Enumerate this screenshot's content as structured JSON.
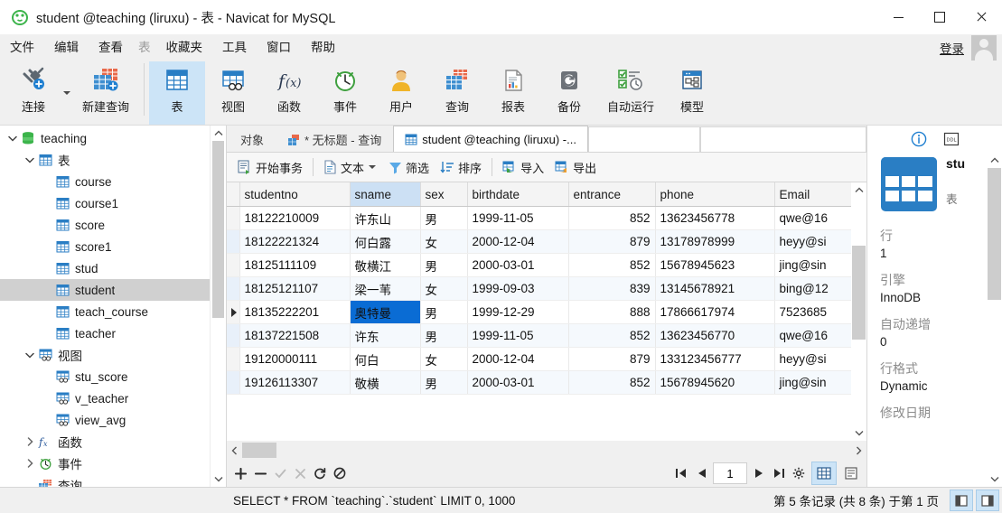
{
  "window": {
    "title": "student @teaching (liruxu) - 表 - Navicat for MySQL",
    "app_icon": "navicat-logo-icon",
    "minimize_label": "最小化",
    "maximize_label": "最大化",
    "close_label": "关闭"
  },
  "menubar": {
    "items": [
      {
        "label": "文件",
        "name": "menu-file",
        "disabled": false
      },
      {
        "label": "编辑",
        "name": "menu-edit",
        "disabled": false
      },
      {
        "label": "查看",
        "name": "menu-view",
        "disabled": false
      },
      {
        "label": "表",
        "name": "menu-table",
        "disabled": true
      },
      {
        "label": "收藏夹",
        "name": "menu-favorites",
        "disabled": false
      },
      {
        "label": "工具",
        "name": "menu-tools",
        "disabled": false
      },
      {
        "label": "窗口",
        "name": "menu-window",
        "disabled": false
      },
      {
        "label": "帮助",
        "name": "menu-help",
        "disabled": false
      }
    ],
    "login_label": "登录"
  },
  "toolbar": {
    "groups": [
      [
        {
          "label": "连接",
          "icon": "connection-icon",
          "name": "toolbar-connection",
          "has_caret": true,
          "wide": false
        },
        {
          "label": "新建查询",
          "icon": "new-query-icon",
          "name": "toolbar-new-query",
          "has_caret": false,
          "wide": true
        }
      ],
      [
        {
          "label": "表",
          "icon": "table-icon",
          "name": "toolbar-table",
          "active": true
        },
        {
          "label": "视图",
          "icon": "view-icon",
          "name": "toolbar-view",
          "active": false
        },
        {
          "label": "函数",
          "icon": "function-icon",
          "name": "toolbar-function",
          "active": false
        },
        {
          "label": "事件",
          "icon": "event-icon",
          "name": "toolbar-event",
          "active": false
        },
        {
          "label": "用户",
          "icon": "user-icon",
          "name": "toolbar-user",
          "active": false
        },
        {
          "label": "查询",
          "icon": "query-icon",
          "name": "toolbar-query",
          "active": false
        },
        {
          "label": "报表",
          "icon": "report-icon",
          "name": "toolbar-report",
          "active": false
        },
        {
          "label": "备份",
          "icon": "backup-icon",
          "name": "toolbar-backup",
          "active": false
        },
        {
          "label": "自动运行",
          "icon": "automation-icon",
          "name": "toolbar-automation",
          "active": false,
          "wide": true
        },
        {
          "label": "模型",
          "icon": "model-icon",
          "name": "toolbar-model",
          "active": false
        }
      ]
    ]
  },
  "sidebar": {
    "items": [
      {
        "label": "teaching",
        "icon": "database-icon",
        "indent": 0,
        "chevron": "down",
        "selected": false
      },
      {
        "label": "表",
        "icon": "table-icon",
        "indent": 1,
        "chevron": "down",
        "selected": false
      },
      {
        "label": "course",
        "icon": "table-icon",
        "indent": 2,
        "chevron": "none",
        "selected": false
      },
      {
        "label": "course1",
        "icon": "table-icon",
        "indent": 2,
        "chevron": "none",
        "selected": false
      },
      {
        "label": "score",
        "icon": "table-icon",
        "indent": 2,
        "chevron": "none",
        "selected": false
      },
      {
        "label": "score1",
        "icon": "table-icon",
        "indent": 2,
        "chevron": "none",
        "selected": false
      },
      {
        "label": "stud",
        "icon": "table-icon",
        "indent": 2,
        "chevron": "none",
        "selected": false
      },
      {
        "label": "student",
        "icon": "table-icon",
        "indent": 2,
        "chevron": "none",
        "selected": true
      },
      {
        "label": "teach_course",
        "icon": "table-icon",
        "indent": 2,
        "chevron": "none",
        "selected": false
      },
      {
        "label": "teacher",
        "icon": "table-icon",
        "indent": 2,
        "chevron": "none",
        "selected": false
      },
      {
        "label": "视图",
        "icon": "view-icon",
        "indent": 1,
        "chevron": "down",
        "selected": false
      },
      {
        "label": "stu_score",
        "icon": "view-icon",
        "indent": 2,
        "chevron": "none",
        "selected": false
      },
      {
        "label": "v_teacher",
        "icon": "view-icon",
        "indent": 2,
        "chevron": "none",
        "selected": false
      },
      {
        "label": "view_avg",
        "icon": "view-icon",
        "indent": 2,
        "chevron": "none",
        "selected": false
      },
      {
        "label": "函数",
        "icon": "function-icon",
        "indent": 1,
        "chevron": "right",
        "selected": false
      },
      {
        "label": "事件",
        "icon": "event-icon",
        "indent": 1,
        "chevron": "right",
        "selected": false
      },
      {
        "label": "查询",
        "icon": "query-icon",
        "indent": 1,
        "chevron": "none",
        "selected": false
      }
    ]
  },
  "tabs": [
    {
      "label": "对象",
      "icon": "none",
      "active": false,
      "name": "tab-objects"
    },
    {
      "label": "* 无标题 - 查询",
      "icon": "query-icon",
      "active": false,
      "name": "tab-untitled-query"
    },
    {
      "label": "student @teaching (liruxu) -...",
      "icon": "table-icon",
      "active": true,
      "name": "tab-student-table"
    }
  ],
  "grid_toolbar": {
    "buttons": [
      {
        "label": "开始事务",
        "icon": "transaction-icon",
        "name": "begin-transaction-button",
        "caret": false
      },
      {
        "label": "文本",
        "icon": "text-icon",
        "name": "text-button",
        "caret": true
      },
      {
        "label": "筛选",
        "icon": "filter-icon",
        "name": "filter-button",
        "caret": false
      },
      {
        "label": "排序",
        "icon": "sort-icon",
        "name": "sort-button",
        "caret": false
      },
      {
        "label": "导入",
        "icon": "import-icon",
        "name": "import-button",
        "caret": false
      },
      {
        "label": "导出",
        "icon": "export-icon",
        "name": "export-button",
        "caret": false
      }
    ]
  },
  "grid": {
    "columns": [
      "studentno",
      "sname",
      "sex",
      "birthdate",
      "entrance",
      "phone",
      "Email"
    ],
    "selected_column": "sname",
    "selected_row_index": 4,
    "selected_cell": {
      "row": 4,
      "column": "sname"
    },
    "rows": [
      {
        "studentno": "18122210009",
        "sname": "许东山",
        "sex": "男",
        "birthdate": "1999-11-05",
        "entrance": "852",
        "phone": "13623456778",
        "Email": "qwe@16"
      },
      {
        "studentno": "18122221324",
        "sname": "何白露",
        "sex": "女",
        "birthdate": "2000-12-04",
        "entrance": "879",
        "phone": "13178978999",
        "Email": "heyy@si"
      },
      {
        "studentno": "18125111109",
        "sname": "敬横江",
        "sex": "男",
        "birthdate": "2000-03-01",
        "entrance": "852",
        "phone": "15678945623",
        "Email": "jing@sin"
      },
      {
        "studentno": "18125121107",
        "sname": "梁一苇",
        "sex": "女",
        "birthdate": "1999-09-03",
        "entrance": "839",
        "phone": "13145678921",
        "Email": "bing@12"
      },
      {
        "studentno": "18135222201",
        "sname": "奥特曼",
        "sex": "男",
        "birthdate": "1999-12-29",
        "entrance": "888",
        "phone": "17866617974",
        "Email": "7523685"
      },
      {
        "studentno": "18137221508",
        "sname": "许东",
        "sex": "男",
        "birthdate": "1999-11-05",
        "entrance": "852",
        "phone": "13623456770",
        "Email": "qwe@16"
      },
      {
        "studentno": "19120000111",
        "sname": "何白",
        "sex": "女",
        "birthdate": "2000-12-04",
        "entrance": "879",
        "phone": "133123456777",
        "Email": "heyy@si"
      },
      {
        "studentno": "19126113307",
        "sname": "敬横",
        "sex": "男",
        "birthdate": "2000-03-01",
        "entrance": "852",
        "phone": "15678945620",
        "Email": "jing@sin"
      }
    ]
  },
  "grid_footer": {
    "record_buttons": [
      {
        "name": "add-record-button",
        "glyph": "+",
        "dim": false
      },
      {
        "name": "delete-record-button",
        "glyph": "−",
        "dim": false
      },
      {
        "name": "confirm-edit-button",
        "glyph": "✓",
        "dim": true
      },
      {
        "name": "cancel-edit-button",
        "glyph": "✕",
        "dim": true
      },
      {
        "name": "refresh-button",
        "glyph": "⟳",
        "dim": false
      },
      {
        "name": "stop-button",
        "glyph": "⦸",
        "dim": false
      }
    ],
    "page_value": "1",
    "nav_buttons": [
      {
        "name": "first-page-button",
        "glyph": "first"
      },
      {
        "name": "prev-page-button",
        "glyph": "prev"
      },
      {
        "name": "next-page-button",
        "glyph": "next"
      },
      {
        "name": "last-page-button",
        "glyph": "last"
      },
      {
        "name": "grid-settings-button",
        "glyph": "gear"
      }
    ],
    "view_grid_label": "网格视图",
    "view_form_label": "表单视图"
  },
  "info_panel": {
    "tab_info": "info-icon",
    "tab_ddl": "ddl-icon",
    "table_name": "stu",
    "object_type": "表",
    "fields": [
      {
        "key": "行",
        "value": "1"
      },
      {
        "key": "引擎",
        "value": "InnoDB"
      },
      {
        "key": "自动递增",
        "value": "0"
      },
      {
        "key": "行格式",
        "value": "Dynamic"
      },
      {
        "key": "修改日期",
        "value": ""
      }
    ]
  },
  "statusbar": {
    "sql": "SELECT * FROM `teaching`.`student` LIMIT 0, 1000",
    "record_info": "第 5 条记录 (共 8 条) 于第 1 页"
  },
  "colors": {
    "accent_blue": "#0a6cd4",
    "header_select": "#cce0f4",
    "toolbar_active": "#cce4f7",
    "tree_select": "#d0d0d0",
    "chrome_bg": "#f0f0f0",
    "grid_alt_row": "#f5f9fd"
  }
}
